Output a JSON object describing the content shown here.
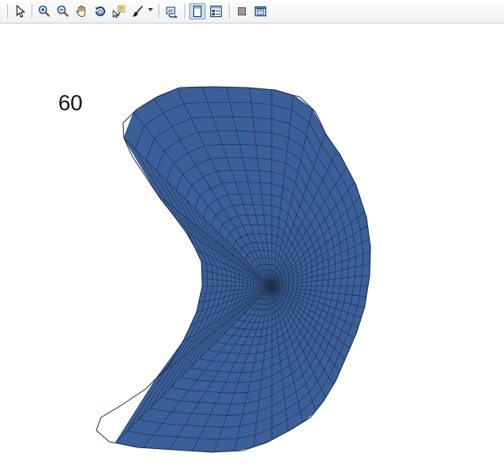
{
  "toolbar": {
    "buttons": [
      {
        "name": "select-pointer-icon"
      },
      {
        "name": "zoom-in-icon"
      },
      {
        "name": "zoom-out-icon"
      },
      {
        "name": "pan-hand-icon"
      },
      {
        "name": "rotate-3d-icon"
      },
      {
        "name": "data-cursor-icon"
      },
      {
        "name": "brush-icon"
      },
      {
        "name": "link-plot-icon"
      },
      {
        "name": "hide-plot-tools-icon",
        "active": true
      },
      {
        "name": "show-plot-tools-icon"
      },
      {
        "name": "property-editor-icon"
      },
      {
        "name": "dock-figure-icon"
      }
    ]
  },
  "figure": {
    "annotation": "60",
    "surface_color": "#3b5f98",
    "edge_color": "#1e2f4d"
  }
}
